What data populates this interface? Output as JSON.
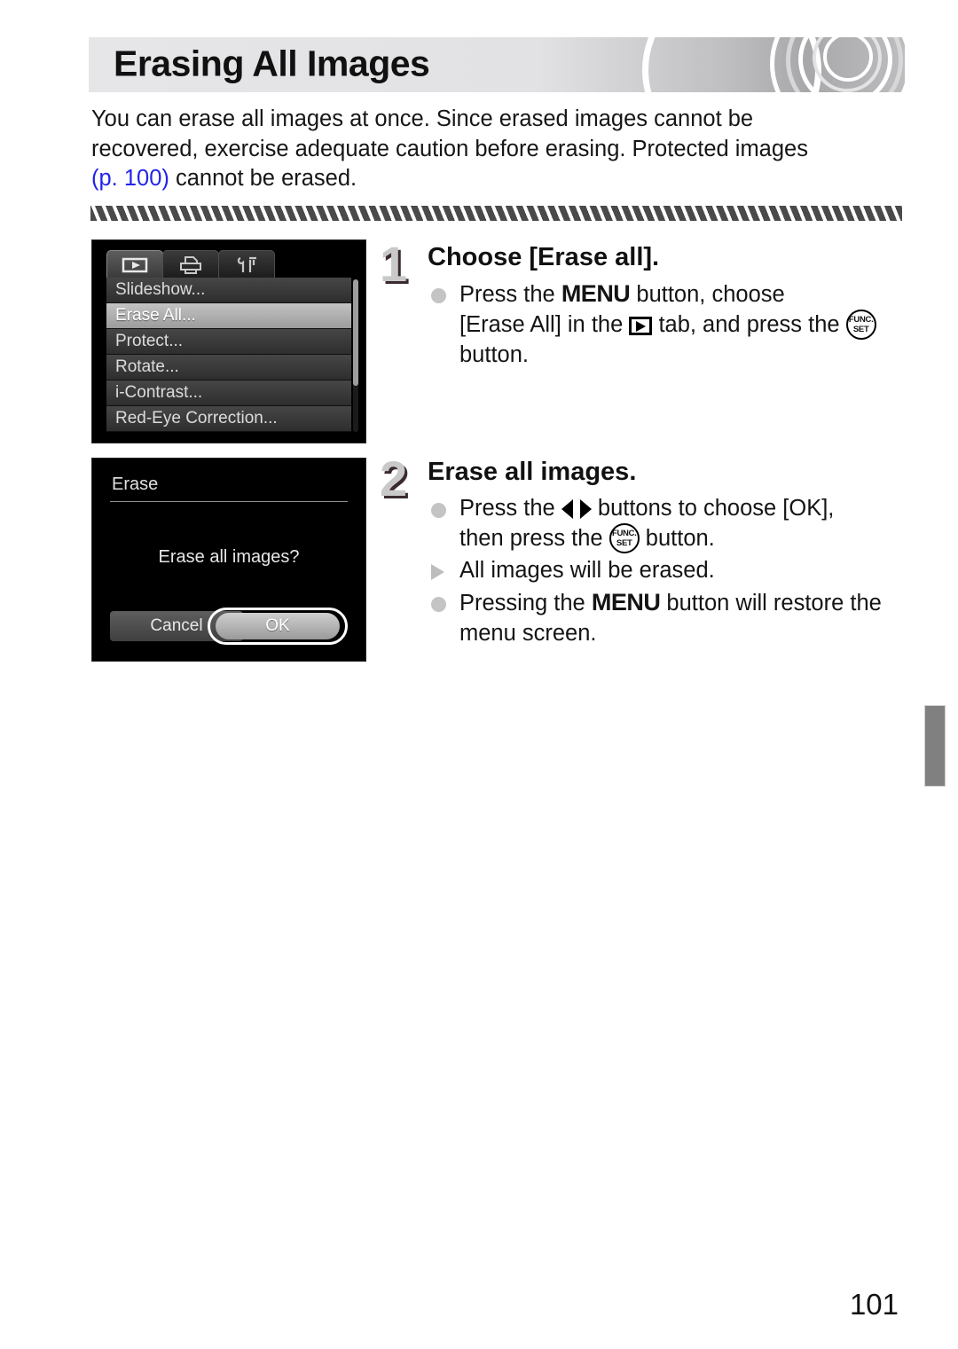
{
  "header": {
    "title": "Erasing All Images",
    "decoration": "concentric-arcs"
  },
  "intro": {
    "line1": "You can erase all images at once. Since erased images cannot be",
    "line2": "recovered, exercise adequate caution before erasing. Protected images",
    "page_ref": "(p. 100)",
    "line3_tail": " cannot be erased."
  },
  "menu_screen": {
    "tabs": [
      {
        "name": "playback-tab",
        "icon": "play-triangle-icon",
        "active": true
      },
      {
        "name": "print-tab",
        "icon": "printer-icon",
        "active": false
      },
      {
        "name": "settings-tab",
        "icon": "wrench-tools-icon",
        "active": false
      }
    ],
    "items": [
      {
        "label": "Slideshow...",
        "selected": false
      },
      {
        "label": "Erase All...",
        "selected": true
      },
      {
        "label": "Protect...",
        "selected": false
      },
      {
        "label": "Rotate...",
        "selected": false
      },
      {
        "label": "i-Contrast...",
        "selected": false
      },
      {
        "label": "Red-Eye Correction...",
        "selected": false
      }
    ]
  },
  "dialog_screen": {
    "title": "Erase",
    "prompt": "Erase all images?",
    "cancel_label": "Cancel",
    "ok_label": "OK",
    "selected_button": "OK"
  },
  "steps": [
    {
      "number": "1",
      "title": "Choose [Erase all].",
      "bullets": [
        {
          "type": "dot",
          "parts": [
            {
              "kind": "text",
              "value": "Press the "
            },
            {
              "kind": "menu-word",
              "value": "MENU"
            },
            {
              "kind": "text",
              "value": " button, choose [Erase All] in the "
            },
            {
              "kind": "icon",
              "value": "playback-icon"
            },
            {
              "kind": "text",
              "value": " tab, and press the "
            },
            {
              "kind": "icon",
              "value": "func-set-icon"
            },
            {
              "kind": "text",
              "value": " button."
            }
          ]
        }
      ]
    },
    {
      "number": "2",
      "title": "Erase all images.",
      "bullets": [
        {
          "type": "dot",
          "parts": [
            {
              "kind": "text",
              "value": "Press the "
            },
            {
              "kind": "icon",
              "value": "left-right-buttons-icon"
            },
            {
              "kind": "text",
              "value": " buttons to choose [OK], then press the "
            },
            {
              "kind": "icon",
              "value": "func-set-icon"
            },
            {
              "kind": "text",
              "value": " button."
            }
          ]
        },
        {
          "type": "triangle",
          "parts": [
            {
              "kind": "text",
              "value": "All images will be erased."
            }
          ]
        },
        {
          "type": "dot",
          "parts": [
            {
              "kind": "text",
              "value": "Pressing the "
            },
            {
              "kind": "menu-word",
              "value": "MENU"
            },
            {
              "kind": "text",
              "value": " button will restore the menu screen."
            }
          ]
        }
      ]
    }
  ],
  "step1_text": {
    "a": "Press the ",
    "menu": "MENU",
    "b": " button, choose",
    "c": "[Erase All] in the ",
    "d": " tab, and press the ",
    "e": "button."
  },
  "step2_text": {
    "a": "Press the ",
    "b": " buttons to choose [OK],",
    "c": "then press the ",
    "d": " button.",
    "e": "All images will be erased.",
    "f": "Pressing the ",
    "menu": "MENU",
    "g": " button will restore the",
    "h": "menu screen."
  },
  "func_icon": {
    "top": "FUNC.",
    "bottom": "SET"
  },
  "page_number": "101",
  "colors": {
    "link_blue": "#2323e8",
    "header_light": "#e6e6e8",
    "header_dark": "#a8a8aa",
    "bullet_gray": "#c4c4c4",
    "step_number_gray": "#c9c9c9",
    "edge_tab_gray": "#808080",
    "menu_selected": "#c3c3c3"
  }
}
